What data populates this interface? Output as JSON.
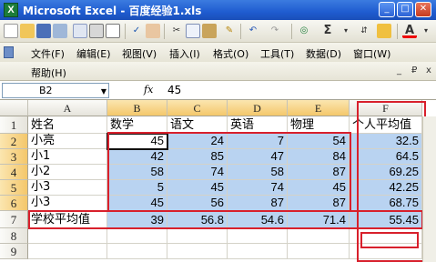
{
  "window": {
    "app_icon": "excel-icon",
    "title": "Microsoft Excel - 百度经验1.xls",
    "controls": {
      "minimize": "_",
      "restore": "□",
      "close": "✕"
    }
  },
  "toolbar": {
    "icons": [
      "new-icon",
      "open-icon",
      "save-icon",
      "permission-icon",
      "email-icon",
      "print-icon",
      "print-preview-icon",
      "spelling-icon",
      "research-icon",
      "cut-icon",
      "copy-icon",
      "paste-icon",
      "format-painter-icon",
      "undo-icon",
      "redo-icon",
      "hyperlink-icon",
      "autosum-icon",
      "sort-icon",
      "font-color-icon"
    ],
    "autosum_label": "Σ",
    "font_color_label": "A"
  },
  "menu": {
    "items": [
      "文件(F)",
      "编辑(E)",
      "视图(V)",
      "插入(I)",
      "格式(O)",
      "工具(T)",
      "数据(D)",
      "窗口(W)"
    ],
    "help": "帮助(H)",
    "doc_controls": [
      "_",
      "₽",
      "x"
    ]
  },
  "formula_bar": {
    "name_box": "B2",
    "fx_label": "fx",
    "value": "45"
  },
  "sheet": {
    "columns": [
      "A",
      "B",
      "C",
      "D",
      "E",
      "F"
    ],
    "rows": [
      "1",
      "2",
      "3",
      "4",
      "5",
      "6",
      "7",
      "8",
      "9"
    ],
    "header_row": [
      "姓名",
      "数学",
      "语文",
      "英语",
      "物理",
      "个人平均值"
    ],
    "data": [
      {
        "name": "小亮",
        "values": [
          "45",
          "24",
          "7",
          "54"
        ],
        "avg": "32.5"
      },
      {
        "name": "小1",
        "values": [
          "42",
          "85",
          "47",
          "84"
        ],
        "avg": "64.5"
      },
      {
        "name": "小2",
        "values": [
          "58",
          "74",
          "58",
          "87"
        ],
        "avg": "69.25"
      },
      {
        "name": "小3",
        "values": [
          "5",
          "45",
          "74",
          "45"
        ],
        "avg": "42.25"
      },
      {
        "name": "小3",
        "values": [
          "45",
          "56",
          "87",
          "87"
        ],
        "avg": "68.75"
      }
    ],
    "summary": {
      "name": "学校平均值",
      "values": [
        "39",
        "56.8",
        "54.6",
        "71.4"
      ],
      "avg": "55.45"
    }
  },
  "colors": {
    "selection": "#b9d3f1",
    "highlight_border": "#d8202c"
  }
}
